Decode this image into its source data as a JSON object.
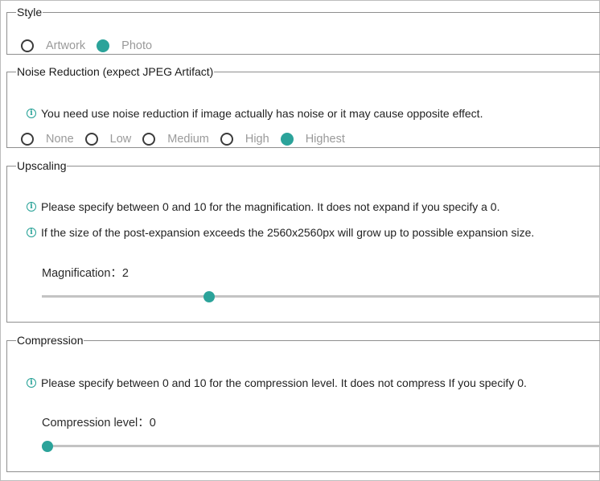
{
  "style": {
    "legend": "Style",
    "options": [
      "Artwork",
      "Photo"
    ],
    "selected": "Photo"
  },
  "noise": {
    "legend": "Noise Reduction (expect JPEG Artifact)",
    "info": "You need use noise reduction if image actually has noise or it may cause opposite effect.",
    "options": [
      "None",
      "Low",
      "Medium",
      "High",
      "Highest"
    ],
    "selected": "Highest"
  },
  "upscaling": {
    "legend": "Upscaling",
    "info1": "Please specify between 0 and 10 for the magnification. It does not expand if you specify a 0.",
    "info2": "If the size of the post-expansion exceeds the 2560x2560px will grow up to possible expansion size.",
    "slider_label": "Magnification：2",
    "value": 2,
    "min": 0,
    "max": 10
  },
  "compression": {
    "legend": "Compression",
    "info": "Please specify between 0 and 10 for the compression level. It does not compress If you specify 0.",
    "slider_label": "Compression level：0",
    "value": 0,
    "min": 0,
    "max": 10
  },
  "colors": {
    "accent": "#2ba39a",
    "track": "#c3c3c3"
  },
  "icons": {
    "info": "info-circle-icon"
  }
}
